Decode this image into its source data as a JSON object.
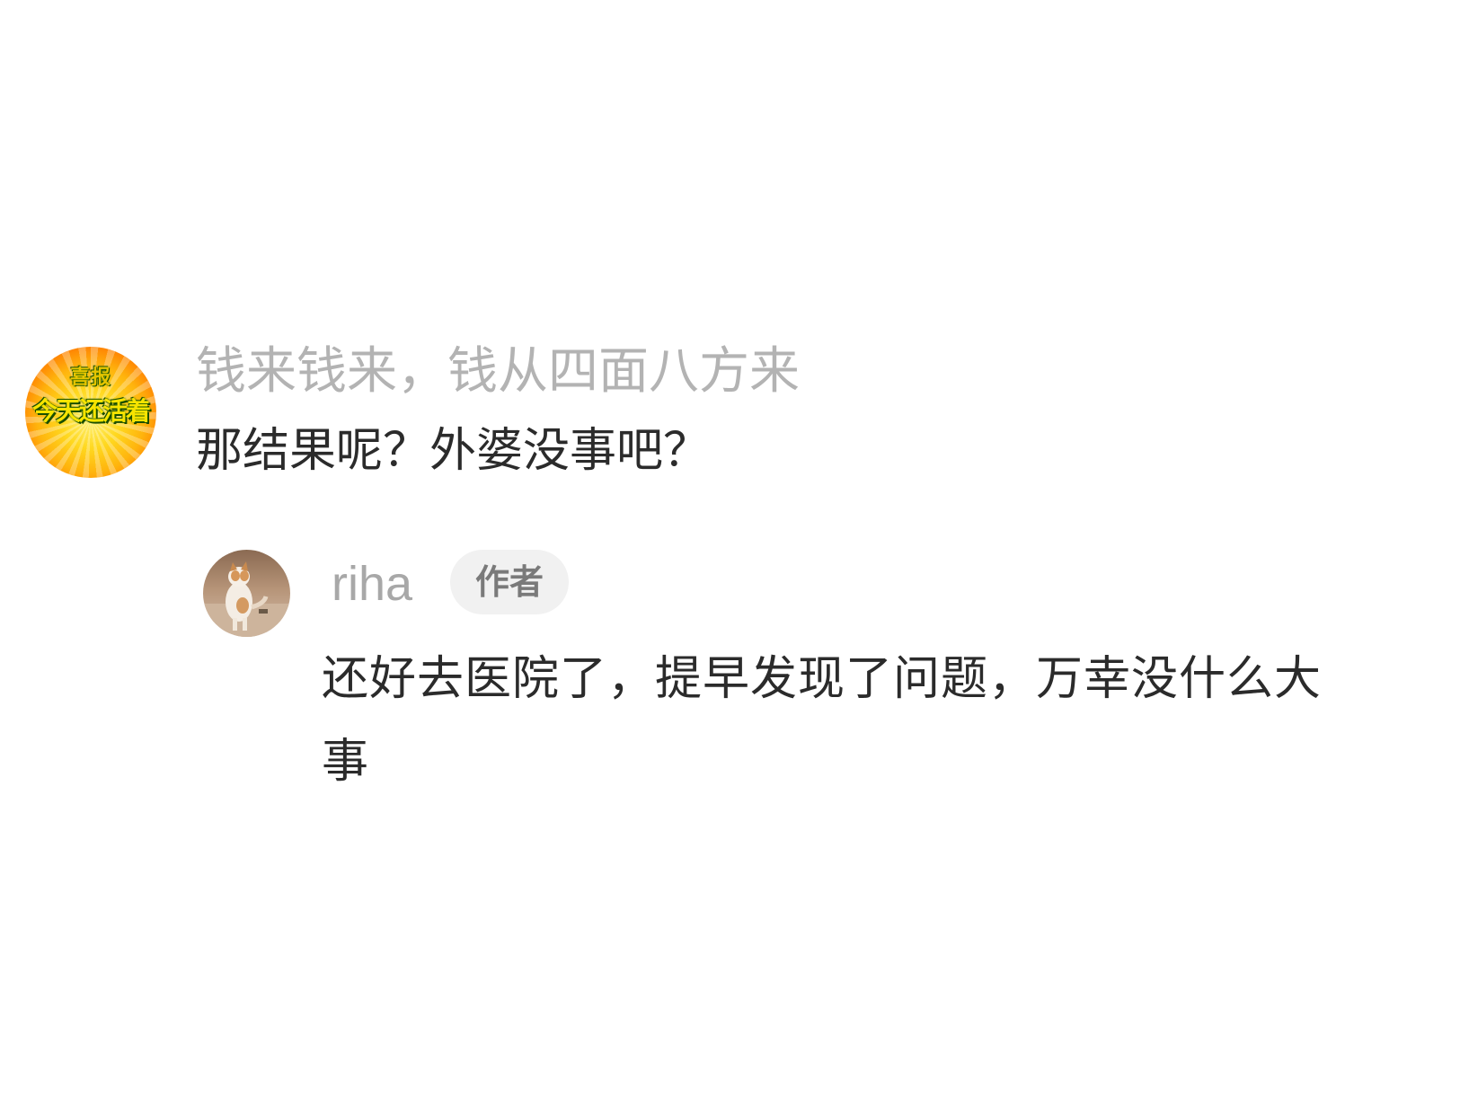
{
  "comment": {
    "avatar": {
      "line1": "喜报",
      "line2": "今天还活着"
    },
    "username": "钱来钱来，钱从四面八方来",
    "text": "那结果呢？外婆没事吧？"
  },
  "reply": {
    "avatar": {
      "icon": "cat-photo-avatar"
    },
    "username": "riha",
    "badge": "作者",
    "text": "还好去医院了，提早发现了问题，万幸没什么大事"
  },
  "colors": {
    "username": "#b3b3b3",
    "body_text": "#2b2b2b",
    "badge_bg": "#f1f1f1",
    "badge_text": "#7a7a7a"
  }
}
